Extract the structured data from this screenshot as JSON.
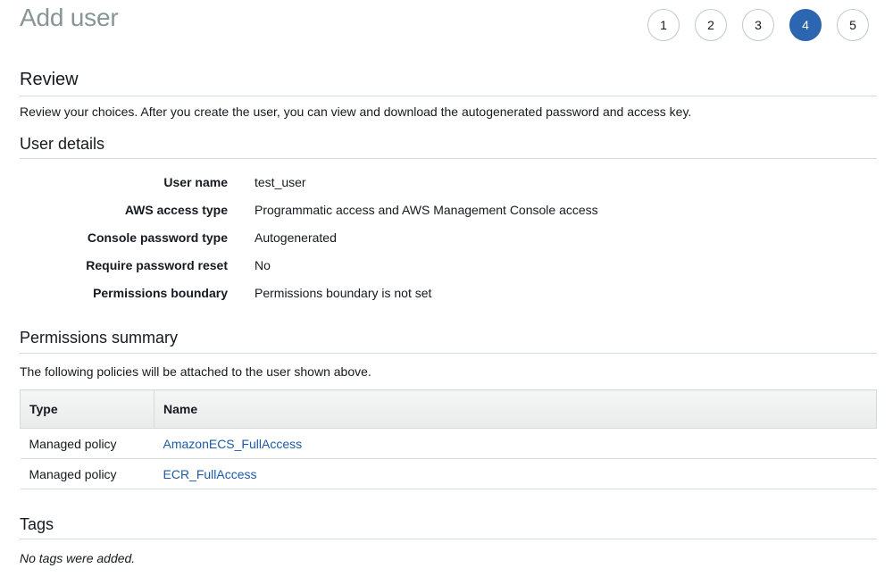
{
  "header": {
    "title": "Add user"
  },
  "steps": [
    "1",
    "2",
    "3",
    "4",
    "5"
  ],
  "active_step": "4",
  "review": {
    "title": "Review",
    "description": "Review your choices. After you create the user, you can view and download the autogenerated password and access key."
  },
  "user_details": {
    "title": "User details",
    "rows": [
      {
        "label": "User name",
        "value": "test_user"
      },
      {
        "label": "AWS access type",
        "value": "Programmatic access and AWS Management Console access"
      },
      {
        "label": "Console password type",
        "value": "Autogenerated"
      },
      {
        "label": "Require password reset",
        "value": "No"
      },
      {
        "label": "Permissions boundary",
        "value": "Permissions boundary is not set"
      }
    ]
  },
  "permissions": {
    "title": "Permissions summary",
    "description": "The following policies will be attached to the user shown above.",
    "columns": [
      "Type",
      "Name"
    ],
    "rows": [
      {
        "type": "Managed policy",
        "name": "AmazonECS_FullAccess"
      },
      {
        "type": "Managed policy",
        "name": "ECR_FullAccess"
      }
    ]
  },
  "tags": {
    "title": "Tags",
    "empty_text": "No tags were added."
  },
  "colors": {
    "accent": "#2c66b0",
    "link": "#1c5aa8",
    "title_gray": "#879596",
    "rule": "#d5dbdb"
  }
}
